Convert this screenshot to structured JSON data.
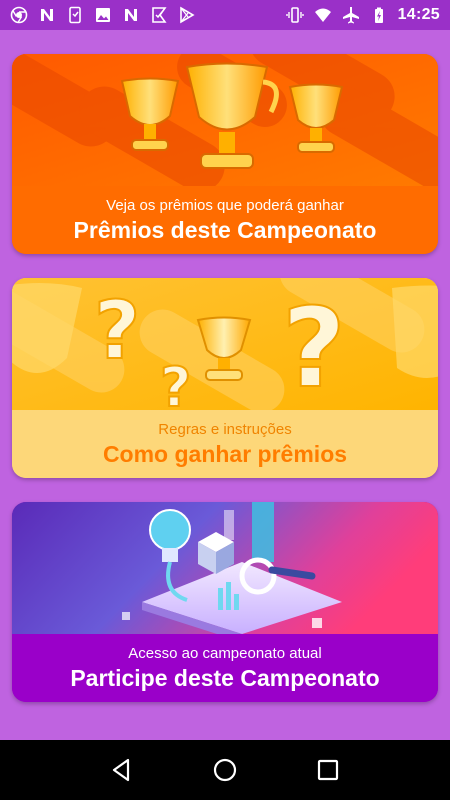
{
  "status_bar": {
    "time": "14:25",
    "left_icons": [
      "chrome-icon",
      "n-icon",
      "phone-icon",
      "image-icon",
      "n-icon",
      "check-icon",
      "play-store-icon"
    ],
    "right_icons": [
      "vibrate-icon",
      "wifi-icon",
      "airplane-icon",
      "battery-charging-icon"
    ]
  },
  "cards": [
    {
      "subtitle": "Veja os prêmios que poderá ganhar",
      "title": "Prêmios deste Campeonato",
      "color": "#ff6a00"
    },
    {
      "subtitle": "Regras e instruções",
      "title": "Como ganhar prêmios",
      "color": "#fdd779"
    },
    {
      "subtitle": "Acesso ao campeonato atual",
      "title": "Participe deste Campeonato",
      "color": "#9a00c8"
    }
  ],
  "nav_bar": {
    "buttons": [
      "back-icon",
      "home-icon",
      "recents-icon"
    ]
  },
  "colors": {
    "background": "#bf63e0",
    "status_bar": "#9a30c8"
  }
}
